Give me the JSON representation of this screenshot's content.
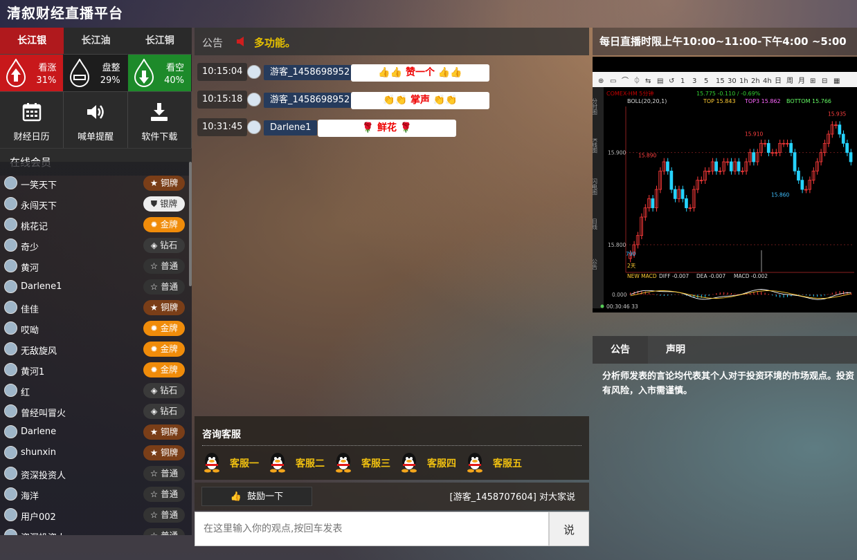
{
  "header": {
    "title": "清叙财经直播平台"
  },
  "markets": {
    "tabs": [
      "长江银",
      "长江油",
      "长江铜"
    ],
    "active": 0
  },
  "sentiment": [
    {
      "label": "看涨",
      "pct": "31%",
      "kind": "up"
    },
    {
      "label": "盘整",
      "pct": "29%",
      "kind": "flat"
    },
    {
      "label": "看空",
      "pct": "40%",
      "kind": "down"
    }
  ],
  "tools": [
    {
      "label": "财经日历",
      "icon": "calendar-icon"
    },
    {
      "label": "喊单提醒",
      "icon": "speaker-icon"
    },
    {
      "label": "软件下载",
      "icon": "download-icon"
    }
  ],
  "online": {
    "title": "在线会员",
    "members": [
      {
        "name": "一笑天下",
        "badge": "铜牌",
        "tier": "bronze"
      },
      {
        "name": "永闯天下",
        "badge": "银牌",
        "tier": "silver"
      },
      {
        "name": "桃花记",
        "badge": "金牌",
        "tier": "gold"
      },
      {
        "name": "奇少",
        "badge": "钻石",
        "tier": "diamond"
      },
      {
        "name": "黄河",
        "badge": "普通",
        "tier": "normal"
      },
      {
        "name": "Darlene1",
        "badge": "普通",
        "tier": "normal"
      },
      {
        "name": "佳佳",
        "badge": "铜牌",
        "tier": "bronze"
      },
      {
        "name": "哎呦",
        "badge": "金牌",
        "tier": "gold"
      },
      {
        "name": "无敌旋风",
        "badge": "金牌",
        "tier": "gold"
      },
      {
        "name": "黄河1",
        "badge": "金牌",
        "tier": "gold"
      },
      {
        "name": "红",
        "badge": "钻石",
        "tier": "diamond"
      },
      {
        "name": "曾经叫冒火",
        "badge": "钻石",
        "tier": "diamond"
      },
      {
        "name": "Darlene",
        "badge": "铜牌",
        "tier": "bronze"
      },
      {
        "name": "shunxin",
        "badge": "铜牌",
        "tier": "bronze"
      },
      {
        "name": "资深投资人",
        "badge": "普通",
        "tier": "normal"
      },
      {
        "name": "海洋",
        "badge": "普通",
        "tier": "normal"
      },
      {
        "name": "用户002",
        "badge": "普通",
        "tier": "normal"
      },
      {
        "name": "资深投资人",
        "badge": "普通",
        "tier": "normal"
      }
    ]
  },
  "notice": {
    "label": "公告",
    "text": "多功能。"
  },
  "chat": [
    {
      "time": "10:15:04",
      "user": "游客_1458698952",
      "content": "👍👍 赞一个 👍👍"
    },
    {
      "time": "10:15:18",
      "user": "游客_1458698952",
      "content": "👏👏 掌声 👏👏"
    },
    {
      "time": "10:31:45",
      "user": "Darlene1",
      "content": "🌹 鲜花 🌹"
    }
  ],
  "service": {
    "title": "咨询客服",
    "agents": [
      "客服一",
      "客服二",
      "客服三",
      "客服四",
      "客服五"
    ]
  },
  "actions": {
    "encourage": "鼓励一下",
    "say_to": "[游客_1458707604] 对大家说"
  },
  "input": {
    "placeholder": "在这里输入你的观点,按回车发表",
    "send": "说"
  },
  "broadcast": {
    "text": "每日直播时限上午10:00~11:00-下午4:00 ~5:00"
  },
  "chart_data": {
    "type": "candlestick",
    "header": "COMEX-HM 5分钟",
    "quote": "15.775  -0.110 / -0.69%",
    "indicator": "BOLL(20,20,1)",
    "indicator_values": {
      "TOP": "15.843",
      "TOP3": "15.862",
      "BOTTOM": "15.766"
    },
    "ytick_labels": [
      "15.900",
      "15.800"
    ],
    "price_labels": [
      "15.890",
      "15.910",
      "15.935",
      "15.860",
      "790"
    ],
    "ylim": [
      15.77,
      15.95
    ],
    "closes": [
      15.79,
      15.8,
      15.81,
      15.83,
      15.84,
      15.85,
      15.84,
      15.86,
      15.88,
      15.89,
      15.88,
      15.86,
      15.85,
      15.86,
      15.85,
      15.84,
      15.84,
      15.86,
      15.87,
      15.87,
      15.88,
      15.88,
      15.89,
      15.88,
      15.88,
      15.89,
      15.89,
      15.88,
      15.89,
      15.88,
      15.88,
      15.89,
      15.9,
      15.89,
      15.9,
      15.91,
      15.91,
      15.9,
      15.9,
      15.9,
      15.91,
      15.91,
      15.91,
      15.9,
      15.88,
      15.87,
      15.86,
      15.86,
      15.87,
      15.88,
      15.89,
      15.9,
      15.91,
      15.92,
      15.93,
      15.93,
      15.92,
      15.91,
      15.9,
      15.89
    ],
    "macd": {
      "label": "NEW MACD",
      "DIFF": "-0.007",
      "DEA": "-0.007",
      "MACD": "-0.002",
      "ytick": "0.000"
    },
    "vol_label": "2天",
    "footer": "00:30:46  33",
    "side_tabs": [
      "分时图",
      "K线图",
      "闪电图",
      "日线",
      "公告"
    ]
  },
  "info": {
    "tabs": [
      "公告",
      "声明"
    ],
    "text": "分析师发表的言论均代表其个人对于投资环境的市场观点。投资有风险，入市需谨慎。"
  },
  "colors": {
    "up": "#c8181b",
    "down": "#1d8a2a",
    "accent": "#e6c000",
    "candle_up": "#ff3b3b",
    "candle_down": "#26d3ff"
  }
}
